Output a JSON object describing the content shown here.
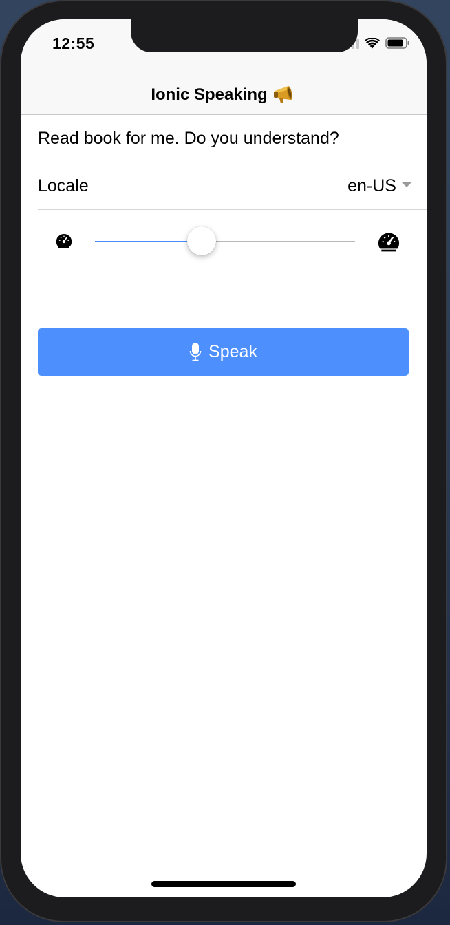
{
  "status_bar": {
    "time": "12:55",
    "signal_bars_active": 1,
    "signal_bars_total": 4,
    "wifi_icon": "wifi-icon",
    "battery_icon": "battery-icon"
  },
  "header": {
    "title": "Ionic Speaking",
    "title_emoji": "📣"
  },
  "form": {
    "text_input_value": "Read book for me. Do you understand?",
    "locale_label": "Locale",
    "locale_value": "en-US",
    "rate_slider": {
      "value_fraction": 0.41,
      "min_icon": "speedometer-slow-icon",
      "max_icon": "speedometer-fast-icon"
    }
  },
  "actions": {
    "speak_label": "Speak",
    "speak_icon": "microphone-icon"
  },
  "colors": {
    "accent": "#4d8ffc",
    "slider_fill": "#4a8bfc",
    "header_bg": "#f8f8f8"
  }
}
